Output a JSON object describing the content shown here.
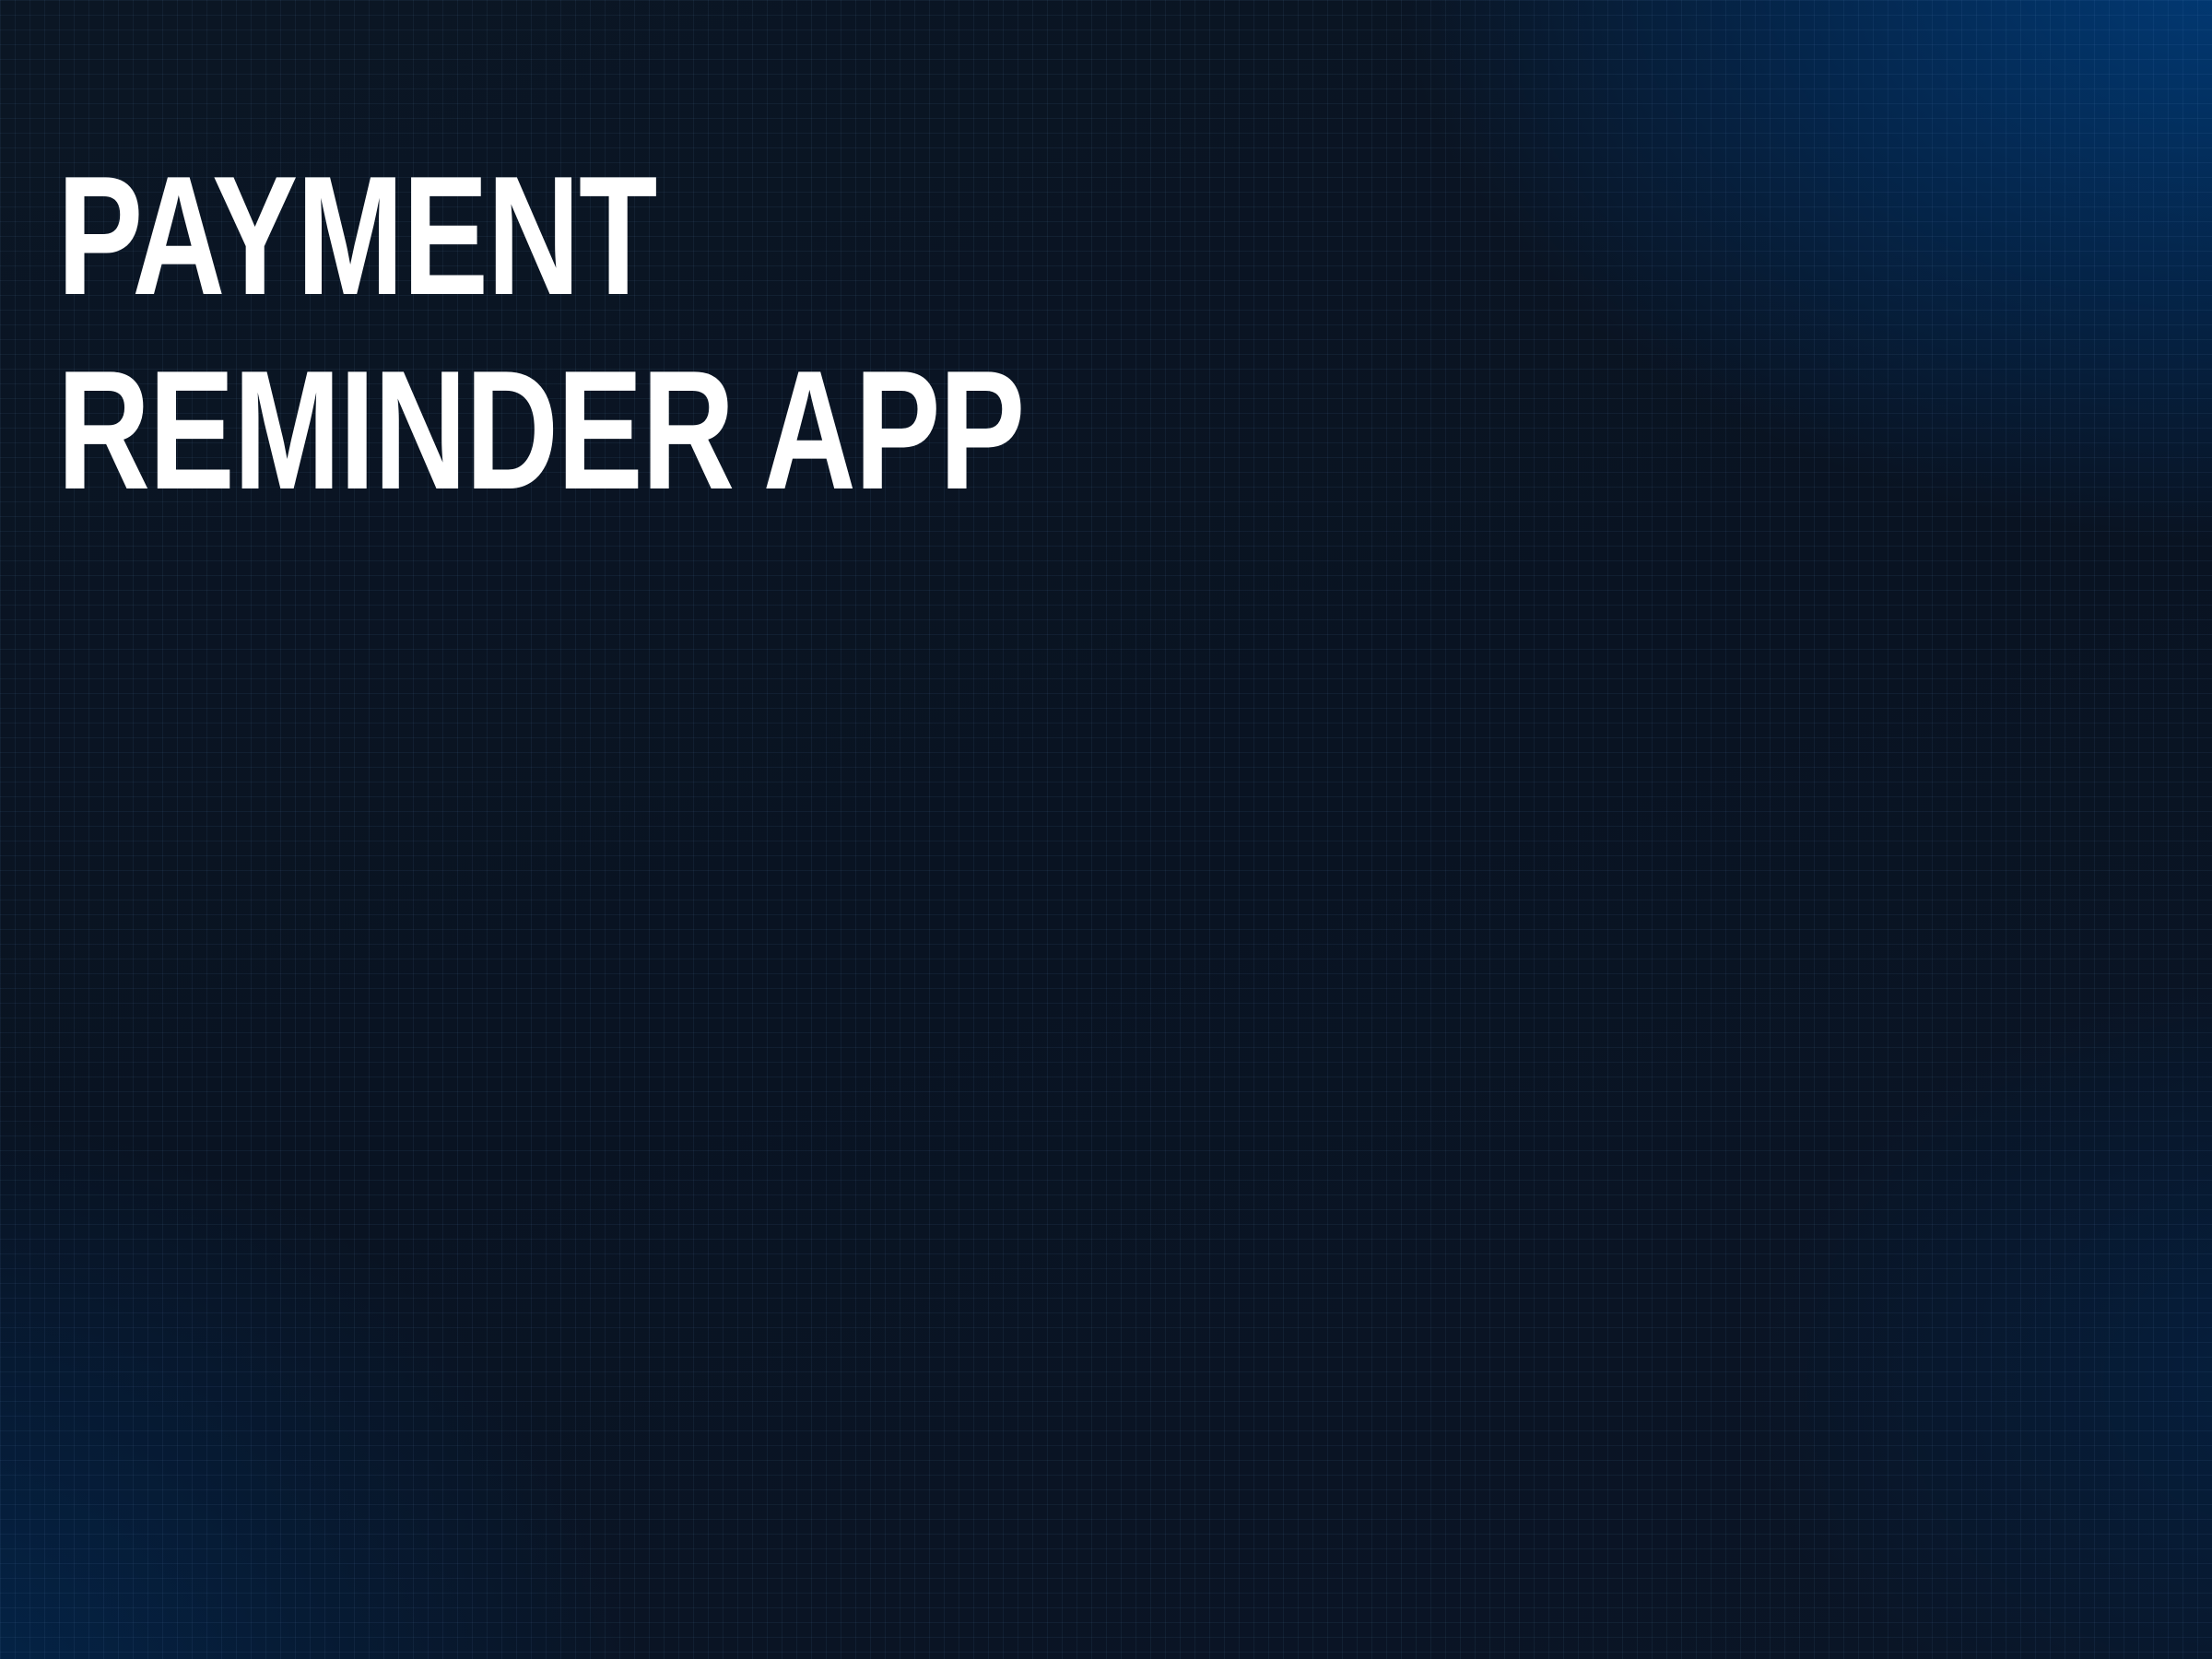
{
  "page": {
    "title": "PAYMENT REMINDER APP"
  },
  "theme": {
    "background_dark": "#0a1422",
    "background_accent": "#003e7e",
    "grid_line": "#78aae6",
    "title_color": "#ffffff"
  }
}
